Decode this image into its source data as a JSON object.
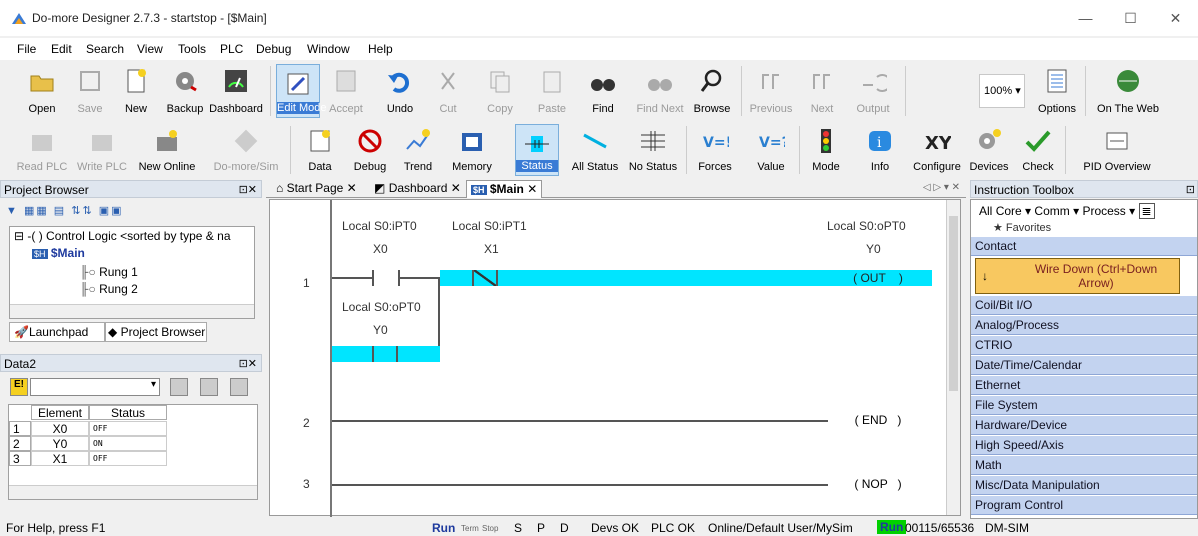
{
  "window": {
    "title": "Do-more Designer 2.7.3 - startstop - [$Main]",
    "minimize": "—",
    "maximize": "☐",
    "close": "✕"
  },
  "menu": [
    "File",
    "Edit",
    "Search",
    "View",
    "Tools",
    "PLC",
    "Debug",
    "Window",
    "Help"
  ],
  "toolbar1": [
    {
      "label": "Open",
      "icon": "open-folder-icon",
      "enabled": true
    },
    {
      "label": "Save",
      "icon": "save-icon",
      "enabled": false
    },
    {
      "label": "New",
      "icon": "new-project-icon",
      "enabled": true
    },
    {
      "label": "Backup",
      "icon": "backup-icon",
      "enabled": true
    },
    {
      "label": "Dashboard",
      "icon": "dashboard-icon",
      "enabled": true
    },
    {
      "label": "Edit Mode",
      "icon": "edit-mode-icon",
      "enabled": true,
      "active": true
    },
    {
      "label": "Accept",
      "icon": "accept-icon",
      "enabled": false
    },
    {
      "label": "Undo",
      "icon": "undo-icon",
      "enabled": true
    },
    {
      "label": "Cut",
      "icon": "cut-icon",
      "enabled": false
    },
    {
      "label": "Copy",
      "icon": "copy-icon",
      "enabled": false
    },
    {
      "label": "Paste",
      "icon": "paste-icon",
      "enabled": false
    },
    {
      "label": "Find",
      "icon": "binoculars-icon",
      "enabled": true
    },
    {
      "label": "Find Next",
      "icon": "find-next-icon",
      "enabled": false
    },
    {
      "label": "Browse",
      "icon": "browse-icon",
      "enabled": true
    },
    {
      "label": "Previous",
      "icon": "previous-icon",
      "enabled": false
    },
    {
      "label": "Next",
      "icon": "next-icon",
      "enabled": false
    },
    {
      "label": "Output",
      "icon": "output-icon",
      "enabled": false
    },
    {
      "label": "100%",
      "icon": "zoom-dropdown",
      "enabled": true
    },
    {
      "label": "Options",
      "icon": "options-icon",
      "enabled": true
    },
    {
      "label": "On The Web",
      "icon": "globe-icon",
      "enabled": true
    }
  ],
  "toolbar2": [
    {
      "label": "Read PLC",
      "icon": "read-plc-icon",
      "enabled": false
    },
    {
      "label": "Write PLC",
      "icon": "write-plc-icon",
      "enabled": false
    },
    {
      "label": "New Online",
      "icon": "new-online-icon",
      "enabled": true
    },
    {
      "label": "Do-more/Sim",
      "icon": "simulator-icon",
      "enabled": false
    },
    {
      "label": "Data",
      "icon": "data-icon",
      "enabled": true
    },
    {
      "label": "Debug",
      "icon": "debug-icon",
      "enabled": true
    },
    {
      "label": "Trend",
      "icon": "trend-icon",
      "enabled": true
    },
    {
      "label": "Memory",
      "icon": "memory-icon",
      "enabled": true
    },
    {
      "label": "Status",
      "icon": "status-icon",
      "enabled": true,
      "active": true
    },
    {
      "label": "All Status",
      "icon": "all-status-icon",
      "enabled": true
    },
    {
      "label": "No Status",
      "icon": "no-status-icon",
      "enabled": true
    },
    {
      "label": "Forces",
      "icon": "forces-icon",
      "enabled": true
    },
    {
      "label": "Value",
      "icon": "value-icon",
      "enabled": true
    },
    {
      "label": "Mode",
      "icon": "mode-icon",
      "enabled": true
    },
    {
      "label": "Info",
      "icon": "info-icon",
      "enabled": true
    },
    {
      "label": "Configure",
      "icon": "configure-icon",
      "enabled": true
    },
    {
      "label": "Devices",
      "icon": "devices-icon",
      "enabled": true
    },
    {
      "label": "Check",
      "icon": "check-icon",
      "enabled": true
    },
    {
      "label": "PID Overview",
      "icon": "pid-overview-icon",
      "enabled": true
    }
  ],
  "project_browser": {
    "title": "Project Browser",
    "tree": [
      {
        "label": "Control Logic <sorted by type & na",
        "level": 0
      },
      {
        "label": "$Main",
        "level": 1
      },
      {
        "label": "Rung 1",
        "level": 2
      },
      {
        "label": "Rung 2",
        "level": 2
      }
    ],
    "tabs": [
      "Launchpad",
      "Project Browser"
    ]
  },
  "data_view": {
    "title": "Data2",
    "columns": [
      "Element",
      "Status"
    ],
    "rows": [
      {
        "n": "1",
        "element": "X0",
        "status": "OFF"
      },
      {
        "n": "2",
        "element": "Y0",
        "status": "ON"
      },
      {
        "n": "3",
        "element": "X1",
        "status": "OFF"
      }
    ]
  },
  "doc_tabs": [
    {
      "label": "Start Page",
      "icon": "home-icon"
    },
    {
      "label": "Dashboard",
      "icon": "dashboard-icon"
    },
    {
      "label": "$Main",
      "icon": "program-icon",
      "active": true
    }
  ],
  "ladder": {
    "rungs": [
      {
        "num": "1",
        "c1_nick": "Local S0:iPT0",
        "c1_addr": "X0",
        "c2_nick": "Local S0:iPT1",
        "c2_addr": "X1",
        "out_nick": "Local S0:oPT0",
        "out_addr": "Y0",
        "out_label": "OUT",
        "br_nick": "Local S0:oPT0",
        "br_addr": "Y0"
      },
      {
        "num": "2",
        "out_label": "END"
      },
      {
        "num": "3",
        "out_label": "NOP"
      }
    ]
  },
  "toolbox": {
    "title": "Instruction Toolbox",
    "filters": [
      "All",
      "Core ▾",
      "Comm ▾",
      "Process ▾"
    ],
    "favorites": "Favorites",
    "selected": "Wire Down (Ctrl+Down Arrow)",
    "categories": [
      "Contact",
      "Coil/Bit I/O",
      "Analog/Process",
      "CTRIO",
      "Date/Time/Calendar",
      "Ethernet",
      "File System",
      "Hardware/Device",
      "High Speed/Axis",
      "Math",
      "Misc/Data Manipulation",
      "Program Control"
    ]
  },
  "status": {
    "help": "For Help, press F1",
    "run": "Run",
    "term": "Term",
    "stop": "Stop",
    "s": "S",
    "p": "P",
    "d": "D",
    "devs": "Devs OK",
    "plc": "PLC OK",
    "user": "Online/Default User/MySim",
    "runbadge": "Run",
    "mem": "00115/65536",
    "sim": "DM-SIM"
  },
  "colors": {
    "accent": "#00e5ff",
    "toolbox_item": "#c3d3f0",
    "run_badge": "#00d000",
    "run_text": "#1e3a9e",
    "selected_item": "#f8c860"
  }
}
